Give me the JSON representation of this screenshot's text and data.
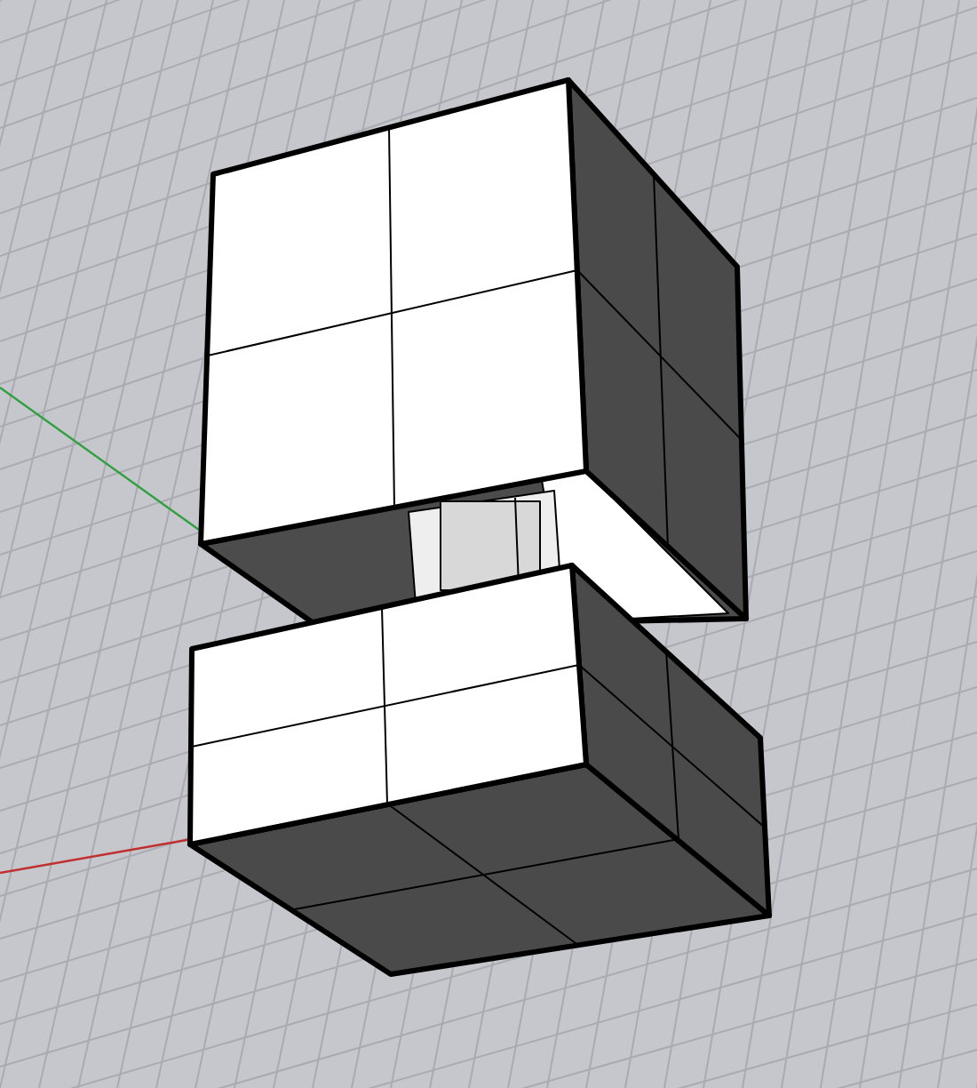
{
  "viewport": {
    "kind": "perspective",
    "show_grid": true,
    "show_axes": true
  }
}
